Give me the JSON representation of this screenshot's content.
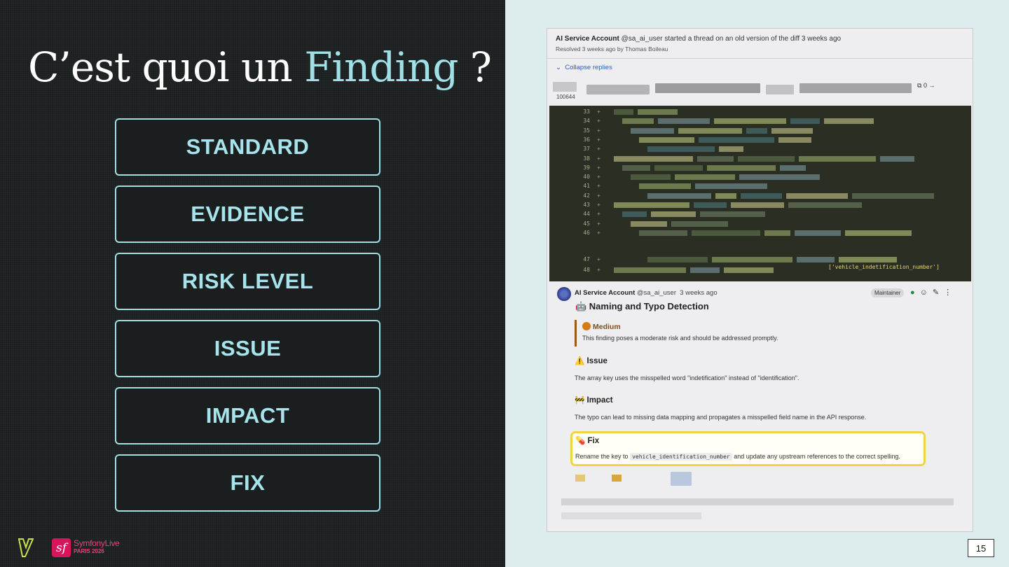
{
  "slide": {
    "title_prefix": "C’est quoi un",
    "title_accent": "Finding",
    "title_suffix": " ?",
    "pills": [
      "STANDARD",
      "EVIDENCE",
      "RISK LEVEL",
      "ISSUE",
      "IMPACT",
      "FIX"
    ],
    "page_number": "15",
    "event_logo": {
      "name": "SymfonyLive",
      "sub": "PARIS 2026",
      "mark": "sf"
    },
    "colors": {
      "accent": "#9fdfe6",
      "background": "#1c2021",
      "right_bg": "#ddeced"
    }
  },
  "screenshot": {
    "thread_author": "AI Service Account",
    "thread_handle": "@sa_ai_user",
    "thread_action": "started a thread on an old version of the diff 3 weeks ago",
    "resolved_text": "Resolved 3 weeks ago by Thomas Boileau",
    "collapse_label": "Collapse replies",
    "file_mode": "100644",
    "copy_label": "0 →",
    "line_numbers": [
      "33",
      "34",
      "35",
      "36",
      "37",
      "38",
      "39",
      "40",
      "41",
      "42",
      "43",
      "44",
      "45",
      "46",
      "47",
      "48"
    ],
    "code_tail": "['vehicle_indetification_number']",
    "comment": {
      "author": "AI Service Account",
      "handle": "@sa_ai_user",
      "time": "3 weeks ago",
      "role_badge": "Maintainer",
      "heading": "🤖 Naming and Typo Detection",
      "risk_level": "Medium",
      "risk_desc": "This finding poses a moderate risk and should be addressed promptly.",
      "issue_heading": "⚠️ Issue",
      "issue_text": "The array key uses the misspelled word \"indetification\" instead of \"identification\".",
      "impact_heading": "🚧 Impact",
      "impact_text": "The typo can lead to missing data mapping and propagates a misspelled field name in the API response.",
      "fix_heading": "💊 Fix",
      "fix_prefix": "Rename the key to",
      "fix_code": "vehicle_identification_number",
      "fix_suffix": "and update any upstream references to the correct spelling."
    }
  }
}
